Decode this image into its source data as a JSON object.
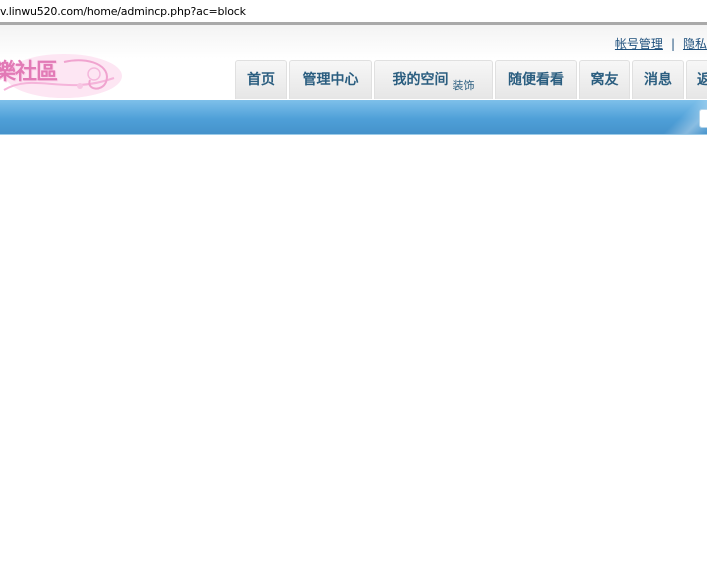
{
  "address_bar": {
    "url": "v.linwu520.com/home/admincp.php?ac=block"
  },
  "header": {
    "logo_text": "樂社區",
    "top_links": {
      "account": "帐号管理",
      "separator": "|",
      "privacy": "隐私"
    }
  },
  "nav": {
    "tabs": [
      {
        "label": "首页",
        "tag": ""
      },
      {
        "label": "管理中心",
        "tag": ""
      },
      {
        "label": "我的空间",
        "tag": "装饰"
      },
      {
        "label": "随便看看",
        "tag": ""
      },
      {
        "label": "窝友",
        "tag": ""
      },
      {
        "label": "消息",
        "tag": ""
      },
      {
        "label": "返回",
        "tag": ""
      }
    ]
  },
  "colors": {
    "nav_text": "#2b5e80",
    "link": "#1d4f7c",
    "bar_blue": "#4fa0d8",
    "logo_pink": "#e27ab6"
  }
}
